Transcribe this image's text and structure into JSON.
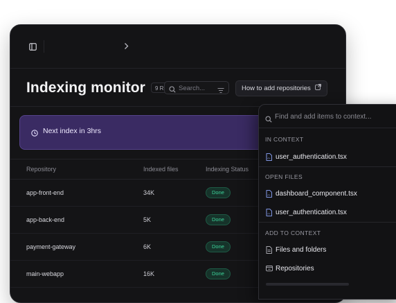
{
  "header": {
    "title": "Indexing monitor",
    "count_badge": "9 Re",
    "search_placeholder": "Search...",
    "howto_label": "How to add repositories"
  },
  "banner": {
    "text": "Next index in 3hrs"
  },
  "table": {
    "columns": [
      "Repository",
      "Indexed files",
      "Indexing Status"
    ],
    "rows": [
      {
        "repo": "app-front-end",
        "files": "34K",
        "status": "Done"
      },
      {
        "repo": "app-back-end",
        "files": "5K",
        "status": "Done"
      },
      {
        "repo": "payment-gateway",
        "files": "6K",
        "status": "Done"
      },
      {
        "repo": "main-webapp",
        "files": "16K",
        "status": "Done"
      }
    ]
  },
  "popover": {
    "search_placeholder": "Find and add items to context...",
    "sections": {
      "in_context": "IN CONTEXT",
      "open_files": "OPEN FILES",
      "add_to_context": "ADD TO CONTEXT"
    },
    "in_context_items": [
      "user_authentication.tsx"
    ],
    "open_files_items": [
      "dashboard_component.tsx",
      "user_authentication.tsx"
    ],
    "add_items": [
      "Files and folders",
      "Repositories"
    ]
  },
  "colors": {
    "background": "#141416",
    "banner": "#3a2b63",
    "status_done": "#3dd39a"
  }
}
